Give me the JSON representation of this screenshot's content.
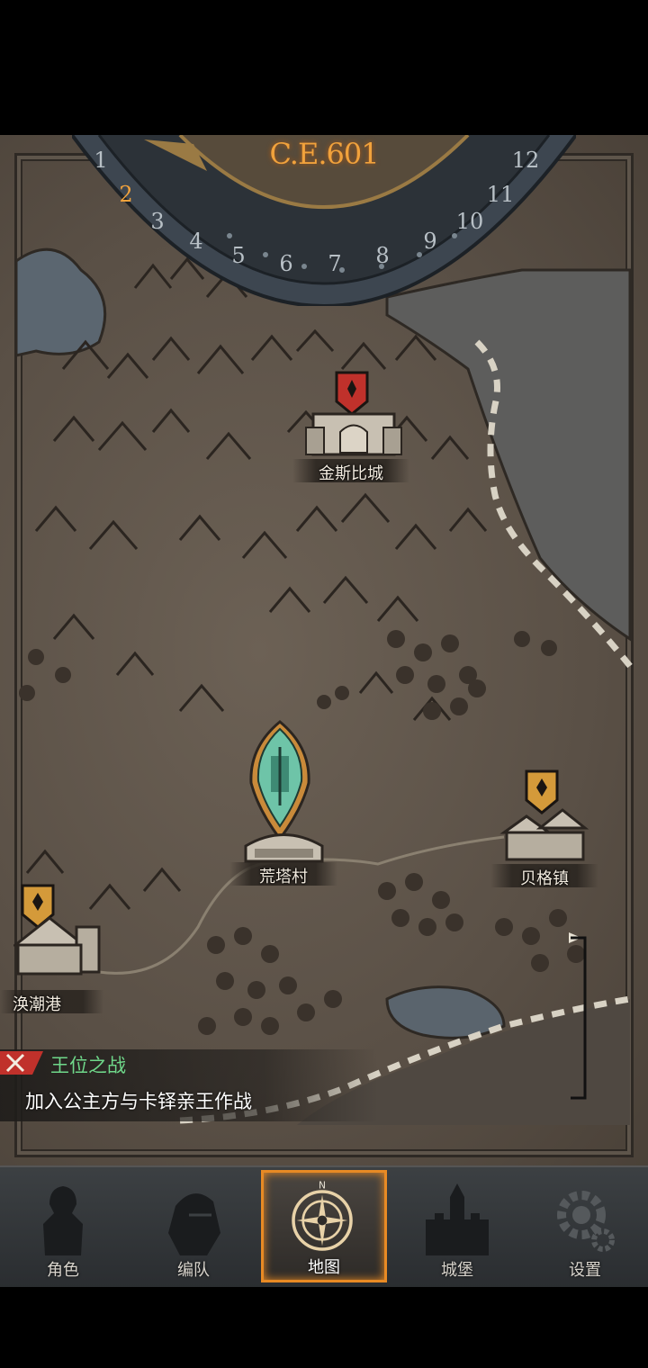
{
  "calendar": {
    "year": "C.E.601",
    "months": [
      "1",
      "2",
      "3",
      "4",
      "5",
      "6",
      "7",
      "8",
      "9",
      "10",
      "11",
      "12"
    ],
    "current_month": "2"
  },
  "cities": {
    "jinsibi": "金斯比城",
    "huangta": "荒塔村",
    "beige": "贝格镇",
    "huanchao": "涣潮港"
  },
  "quest": {
    "title": "王位之战",
    "description": "加入公主方与卡铎亲王作战"
  },
  "nav": {
    "character": "角色",
    "team": "编队",
    "map": "地图",
    "castle": "城堡",
    "settings": "设置",
    "compass_n": "N"
  },
  "colors": {
    "accent": "#e88a24",
    "quest_green": "#6fd88a",
    "banner_red": "#c0312b",
    "banner_gold": "#d49a3a",
    "hero_teal": "#6ec4a8"
  }
}
